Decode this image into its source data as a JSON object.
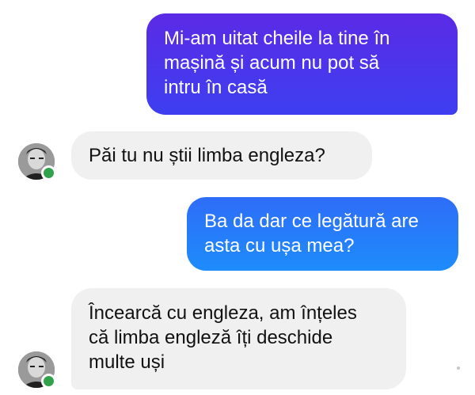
{
  "conversation": {
    "messages": [
      {
        "direction": "outgoing",
        "text": "Mi-am uitat cheile la tine în\nmașină și acum nu pot să\nintru în casă"
      },
      {
        "direction": "incoming",
        "text": "Păi tu nu știi limba engleza?"
      },
      {
        "direction": "outgoing",
        "text": "Ba da dar ce legătură are\nasta cu ușa mea?"
      },
      {
        "direction": "incoming",
        "text": "Încearcă cu engleza, am înțeles\ncă limba engleză îți deschide\nmulte uși"
      }
    ]
  },
  "contact": {
    "avatar_icon": "person-photo",
    "status": "online",
    "status_color": "#31a24c"
  },
  "colors": {
    "outgoing_primary": "#4b33ec",
    "outgoing_secondary": "#267bfa",
    "incoming_bg": "#f0f0f0"
  }
}
